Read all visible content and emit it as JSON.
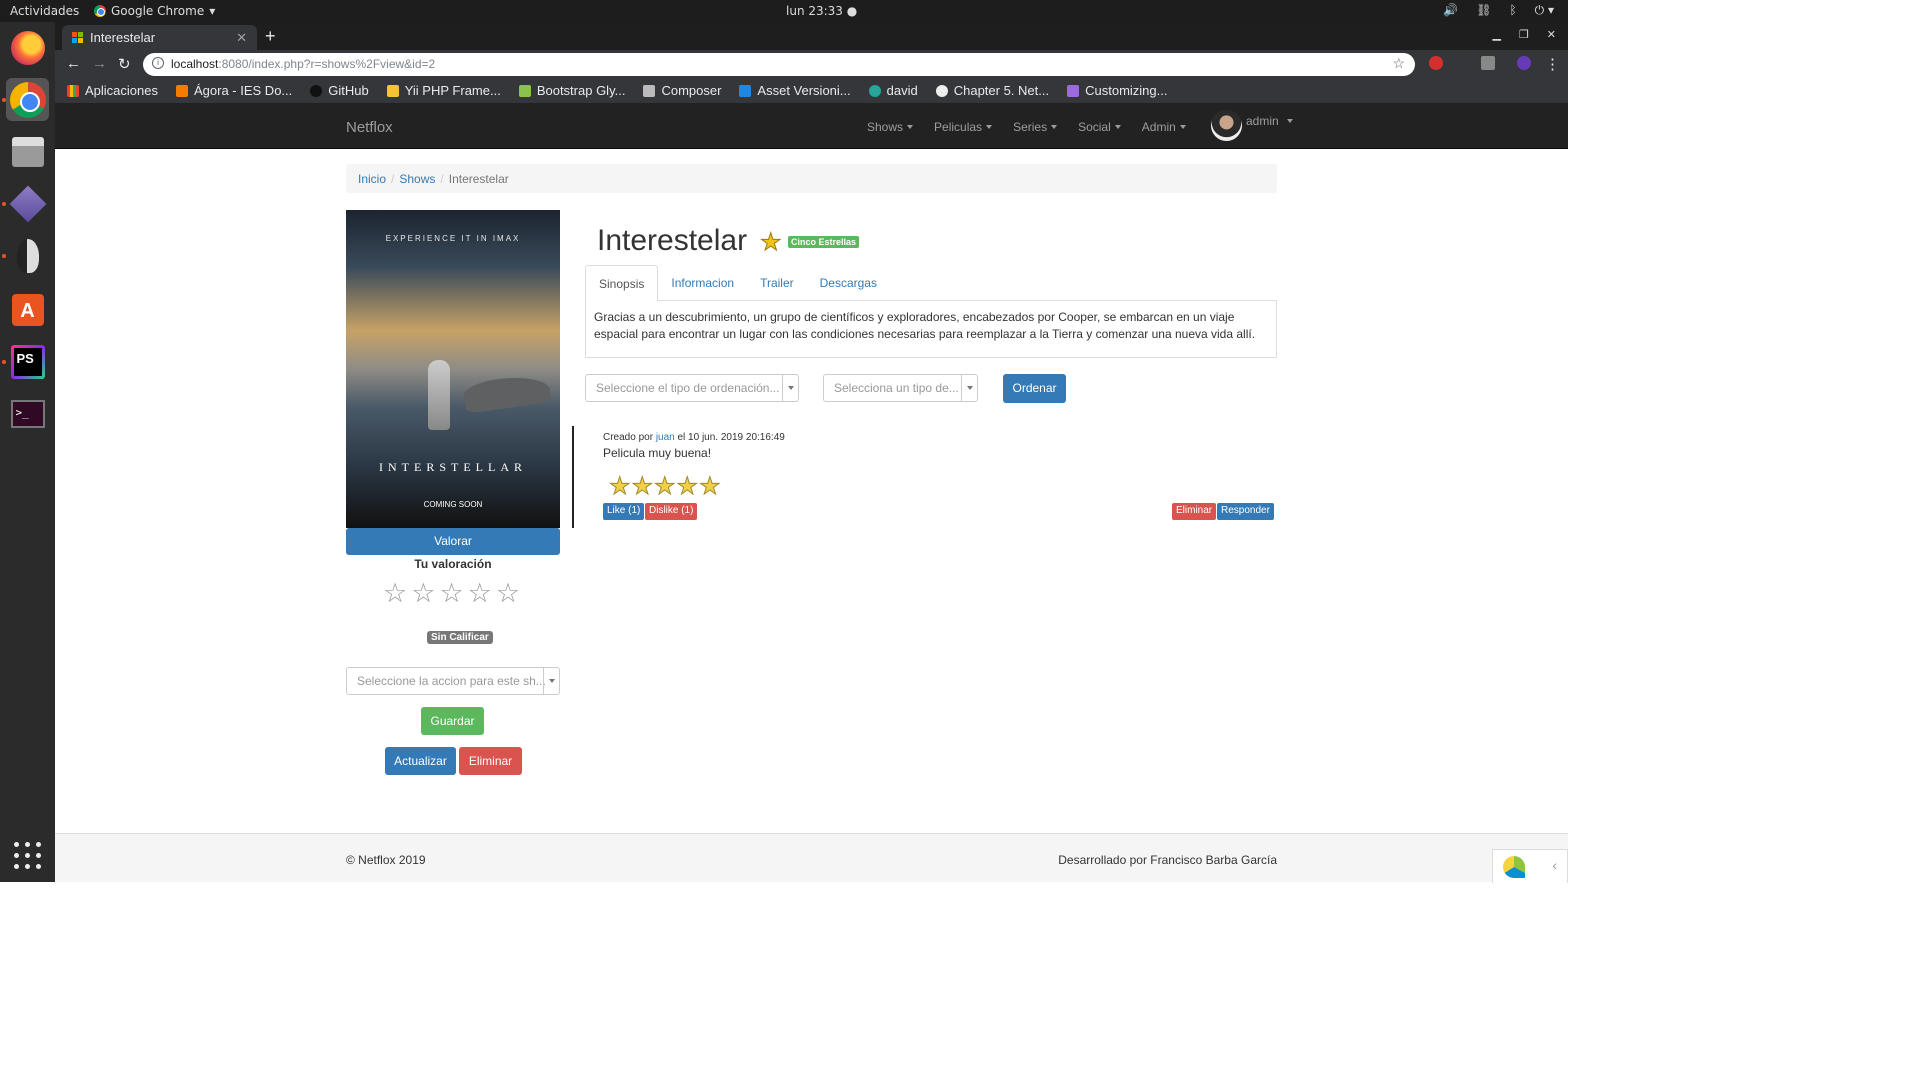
{
  "os": {
    "activities": "Actividades",
    "app_name": "Google Chrome",
    "clock": "lun 23:33 ●"
  },
  "browser": {
    "tab_title": "Interestelar",
    "url_host": "localhost",
    "url_path": ":8080/index.php?r=shows%2Fview&id=2",
    "bookmarks": [
      "Aplicaciones",
      "Ágora - IES Do...",
      "GitHub",
      "Yii PHP Frame...",
      "Bootstrap Gly...",
      "Composer",
      "Asset Versioni...",
      "david",
      "Chapter 5. Net...",
      "Customizing..."
    ]
  },
  "navbar": {
    "brand": "Netflox",
    "items": [
      "Shows",
      "Peliculas",
      "Series",
      "Social",
      "Admin"
    ],
    "user": "admin"
  },
  "breadcrumb": {
    "home": "Inicio",
    "section": "Shows",
    "current": "Interestelar"
  },
  "poster": {
    "tagline": "EXPERIENCE IT IN IMAX",
    "title": "INTERSTELLAR",
    "coming": "COMING SOON"
  },
  "sidebar": {
    "valorar_button": "Valorar",
    "rating_label": "Tu valoración",
    "rating_value": 0,
    "rating_badge": "Sin Calificar",
    "action_placeholder": "Seleccione la accion para este sh...",
    "save_button": "Guardar",
    "update_button": "Actualizar",
    "delete_button": "Eliminar"
  },
  "show": {
    "title": "Interestelar",
    "badge": "Cinco Estrellas",
    "tabs": [
      "Sinopsis",
      "Informacion",
      "Trailer",
      "Descargas"
    ],
    "synopsis": "Gracias a un descubrimiento, un grupo de científicos y exploradores, encabezados por Cooper, se embarcan en un viaje espacial para encontrar un lugar con las condiciones necesarias para reemplazar a la Tierra y comenzar una nueva vida allí."
  },
  "sorting": {
    "order_placeholder": "Seleccione el tipo de ordenación...",
    "type_placeholder": "Selecciona un tipo de...",
    "order_button": "Ordenar"
  },
  "comment": {
    "meta_prefix": "Creado por",
    "author": "juan",
    "meta_suffix": "el 10 jun. 2019 20:16:49",
    "text": "Pelicula muy buena!",
    "stars": 5,
    "like": "Like (1)",
    "dislike": "Dislike (1)",
    "delete": "Eliminar",
    "reply": "Responder"
  },
  "footer": {
    "left": "© Netflox 2019",
    "right": "Desarrollado por Francisco Barba García"
  }
}
